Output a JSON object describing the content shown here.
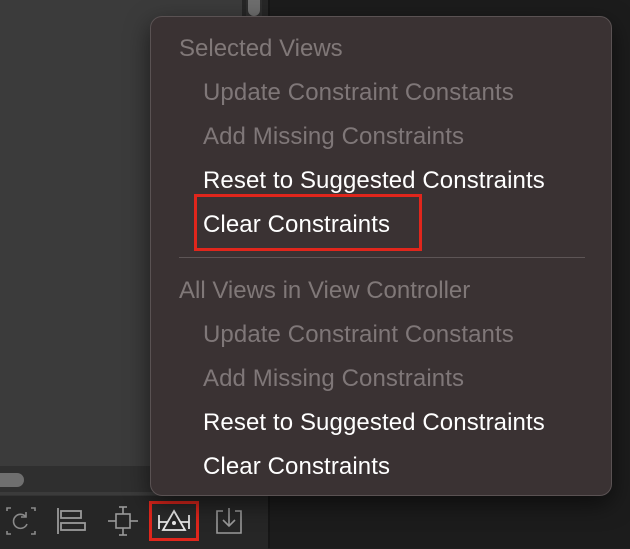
{
  "menu": {
    "sections": [
      {
        "header": "Selected Views",
        "items": [
          {
            "label": "Update Constraint Constants",
            "enabled": false
          },
          {
            "label": "Add Missing Constraints",
            "enabled": false
          },
          {
            "label": "Reset to Suggested Constraints",
            "enabled": true
          },
          {
            "label": "Clear Constraints",
            "enabled": true,
            "highlighted": true
          }
        ]
      },
      {
        "header": "All Views in View Controller",
        "items": [
          {
            "label": "Update Constraint Constants",
            "enabled": false
          },
          {
            "label": "Add Missing Constraints",
            "enabled": false
          },
          {
            "label": "Reset to Suggested Constraints",
            "enabled": true
          },
          {
            "label": "Clear Constraints",
            "enabled": true
          }
        ]
      }
    ]
  },
  "toolbar": {
    "icons": [
      {
        "name": "update-frames-icon"
      },
      {
        "name": "align-icon"
      },
      {
        "name": "add-new-constraints-icon"
      },
      {
        "name": "resolve-auto-layout-issues-icon",
        "active": true
      },
      {
        "name": "embed-in-icon"
      }
    ]
  },
  "colors": {
    "menu_background": "#3a3233",
    "highlight_outline": "#e0261c",
    "enabled_text": "#ffffff",
    "disabled_text": "#7f7778"
  }
}
